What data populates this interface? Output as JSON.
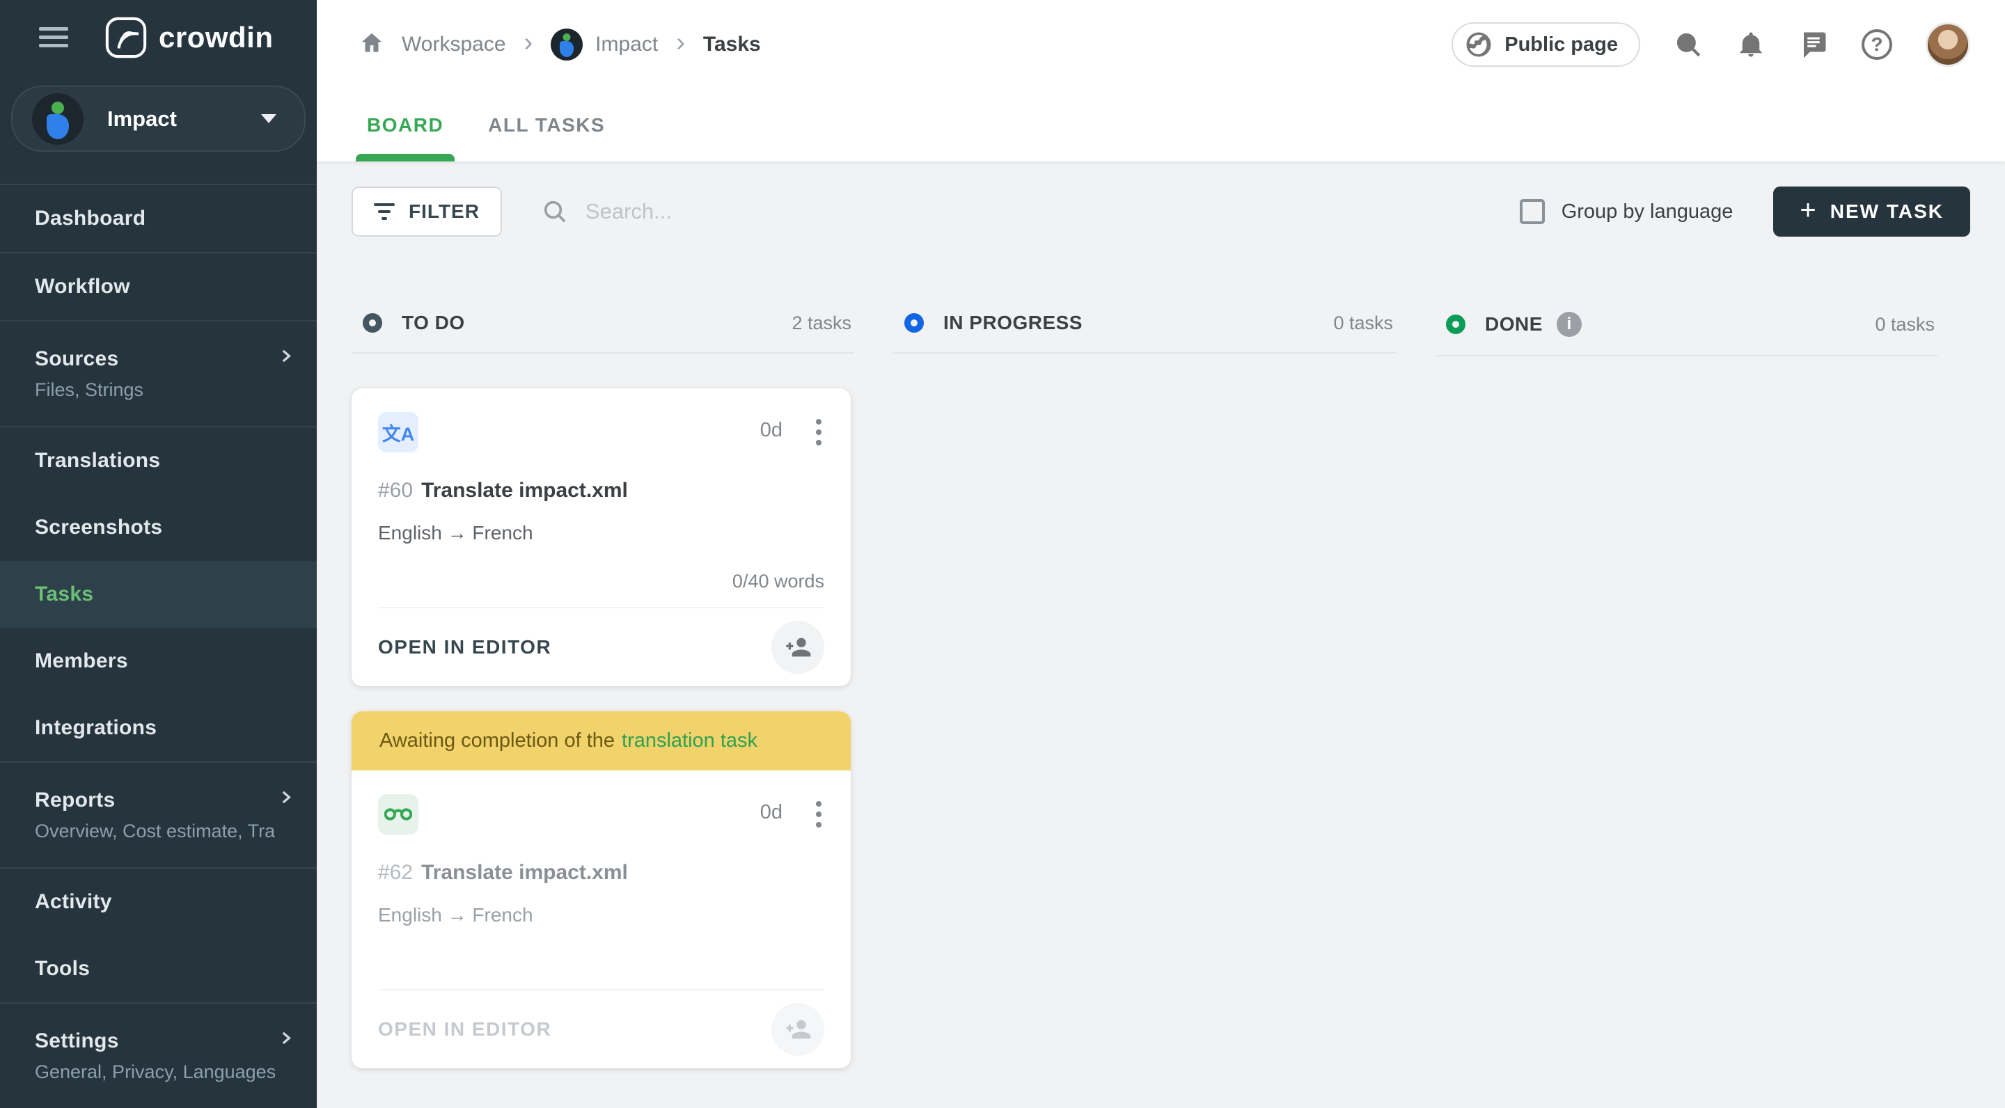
{
  "app": {
    "logo_text": "crowdin"
  },
  "sidebar": {
    "project_name": "Impact",
    "items": [
      {
        "label": "Dashboard"
      },
      {
        "label": "Workflow"
      },
      {
        "label": "Sources",
        "subtitle": "Files, Strings"
      },
      {
        "label": "Translations"
      },
      {
        "label": "Screenshots"
      },
      {
        "label": "Tasks"
      },
      {
        "label": "Members"
      },
      {
        "label": "Integrations"
      },
      {
        "label": "Reports",
        "subtitle": "Overview, Cost estimate, Transl…"
      },
      {
        "label": "Activity"
      },
      {
        "label": "Tools"
      },
      {
        "label": "Settings",
        "subtitle": "General, Privacy, Languages, Q…"
      }
    ]
  },
  "header": {
    "breadcrumb": {
      "workspace": "Workspace",
      "project": "Impact",
      "page": "Tasks",
      "separator": "›"
    },
    "public_page": "Public page",
    "tabs": {
      "board": "BOARD",
      "all_tasks": "ALL TASKS"
    }
  },
  "toolbar": {
    "filter": "FILTER",
    "search_placeholder": "Search...",
    "group_by_language": "Group by language",
    "new_task": "NEW TASK"
  },
  "board": {
    "columns": [
      {
        "name": "TO DO",
        "count": "2 tasks"
      },
      {
        "name": "IN PROGRESS",
        "count": "0 tasks"
      },
      {
        "name": "DONE",
        "count": "0 tasks"
      }
    ],
    "cards": [
      {
        "id": "#60",
        "title": "Translate impact.xml",
        "languages": "English → French",
        "due": "0d",
        "words": "0/40 words",
        "action": "OPEN IN EDITOR"
      },
      {
        "id": "#62",
        "title": "Translate impact.xml",
        "languages": "English → French",
        "due": "0d",
        "action": "OPEN IN EDITOR",
        "banner_text": "Awaiting completion of the",
        "banner_link": "translation task"
      }
    ]
  },
  "icons": {
    "help": "?",
    "info": "i",
    "plus": "+",
    "translate_glyph": "文A"
  },
  "colors": {
    "sidebar_bg": "#26343D",
    "accent_green": "#36A854",
    "active_item_green": "#6CBF78",
    "progress_blue": "#1266E3",
    "done_green": "#0B9D58",
    "todo_slate": "#44565F",
    "banner_yellow": "#F2D36B",
    "banner_link_green": "#2FA052",
    "button_dark": "#26343D"
  }
}
